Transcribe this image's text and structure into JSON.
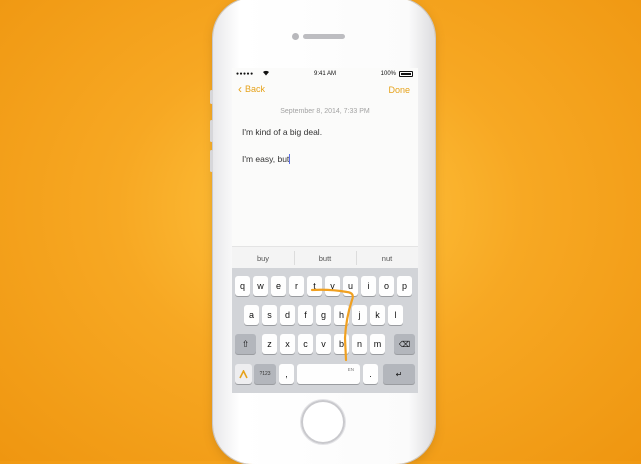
{
  "status_bar": {
    "signal": "●●●●●",
    "wifi": "📶",
    "time": "9:41 AM",
    "battery_pct": "100%"
  },
  "nav": {
    "back_label": "Back",
    "done_label": "Done"
  },
  "note": {
    "date": "September 8, 2014, 7:33 PM",
    "line1": "I'm kind of a big deal.",
    "line2": "I'm easy, but"
  },
  "suggestions": [
    "buy",
    "butt",
    "nut"
  ],
  "keyboard": {
    "row1": [
      "q",
      "w",
      "e",
      "r",
      "t",
      "y",
      "u",
      "i",
      "o",
      "p"
    ],
    "row2": [
      "a",
      "s",
      "d",
      "f",
      "g",
      "h",
      "j",
      "k",
      "l"
    ],
    "row3": [
      "z",
      "x",
      "c",
      "v",
      "b",
      "n",
      "m"
    ],
    "num_label": "?123",
    "comma": ",",
    "space_label": "EN",
    "period": ".",
    "return_glyph": "↵",
    "shift_glyph": "⇧",
    "backspace_glyph": "⌫"
  },
  "colors": {
    "accent": "#e6a21a",
    "background": "#f7a823",
    "swipe_trail": "#f0a020"
  }
}
